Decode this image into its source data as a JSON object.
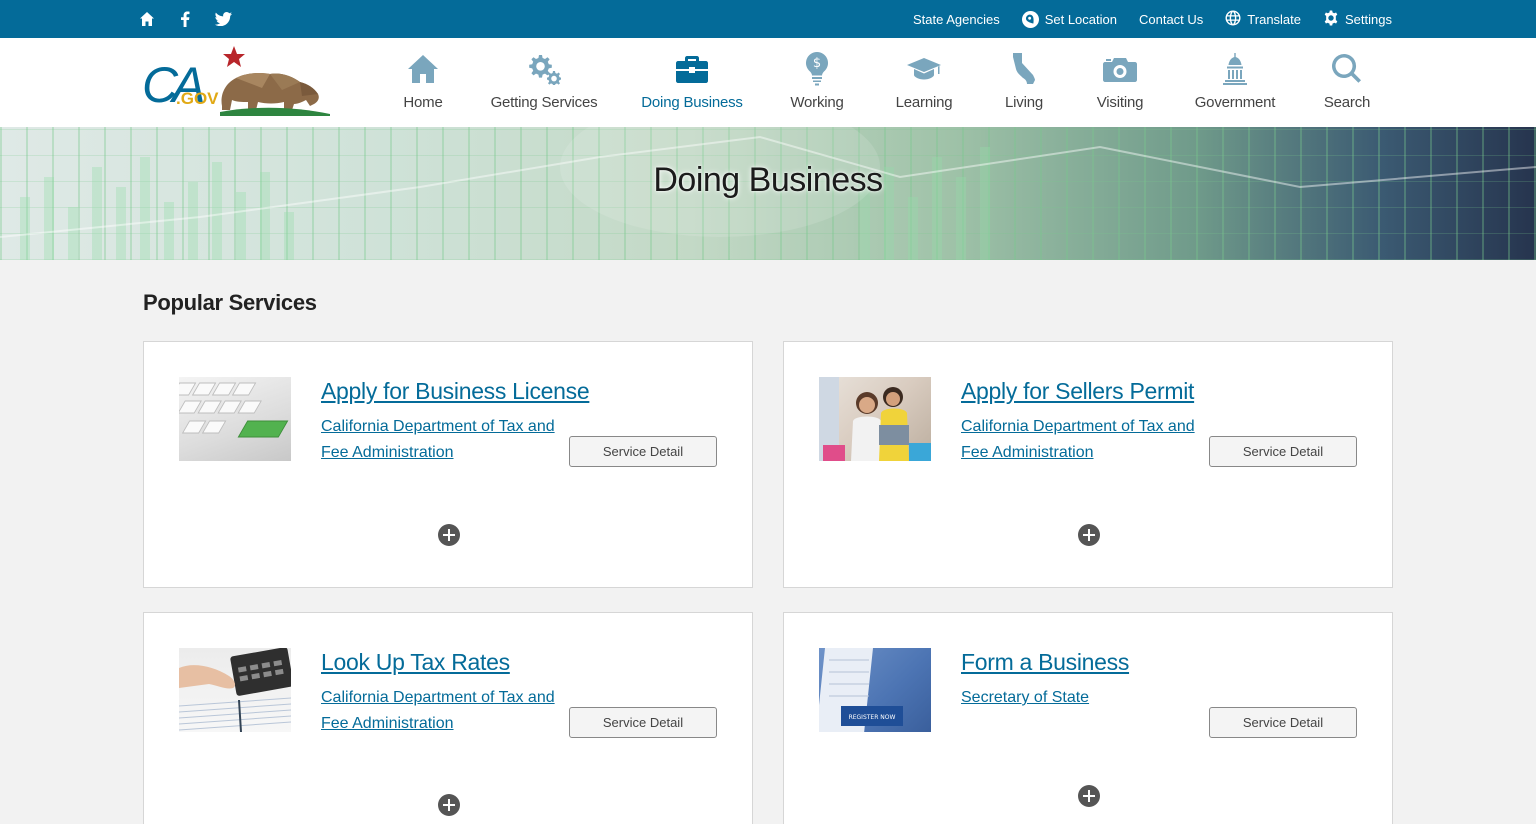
{
  "utility": {
    "social": [
      "home-icon",
      "facebook-icon",
      "twitter-icon"
    ],
    "links": {
      "state_agencies": "State Agencies",
      "set_location": "Set Location",
      "contact_us": "Contact Us",
      "translate": "Translate",
      "settings": "Settings"
    }
  },
  "header": {
    "logo_text": "CA.GOV",
    "nav": [
      {
        "label": "Home",
        "icon": "house-icon"
      },
      {
        "label": "Getting Services",
        "icon": "gears-icon"
      },
      {
        "label": "Doing Business",
        "icon": "briefcase-icon",
        "active": true
      },
      {
        "label": "Working",
        "icon": "lightbulb-dollar-icon"
      },
      {
        "label": "Learning",
        "icon": "graduation-cap-icon"
      },
      {
        "label": "Living",
        "icon": "california-map-icon"
      },
      {
        "label": "Visiting",
        "icon": "camera-icon"
      },
      {
        "label": "Government",
        "icon": "capitol-icon"
      },
      {
        "label": "Search",
        "icon": "search-icon"
      }
    ]
  },
  "hero": {
    "title": "Doing Business"
  },
  "main": {
    "section_title": "Popular Services",
    "cards": [
      {
        "title": "Apply for Business License",
        "agency": "California Department of Tax and Fee Administration",
        "button": "Service Detail",
        "thumb": "keyboard-apply-key-image"
      },
      {
        "title": "Apply for Sellers Permit",
        "agency": "California Department of Tax and Fee Administration",
        "button": "Service Detail",
        "thumb": "women-at-laptop-image"
      },
      {
        "title": "Look Up Tax Rates",
        "agency": "California Department of Tax and Fee Administration",
        "button": "Service Detail",
        "thumb": "calculator-hand-image"
      },
      {
        "title": "Form a Business",
        "agency": "Secretary of State",
        "button": "Service Detail",
        "thumb": "register-now-form-image"
      }
    ]
  },
  "colors": {
    "brand_blue": "#046b99",
    "page_bg": "#f2f2f2",
    "nav_icon": "#7aa6bd"
  }
}
